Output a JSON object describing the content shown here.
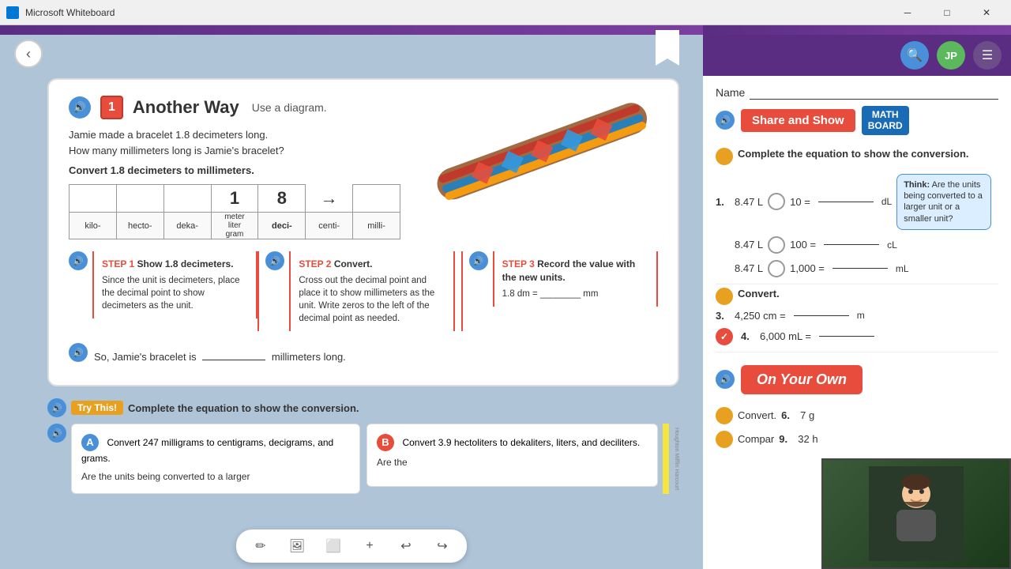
{
  "titleBar": {
    "title": "Microsoft Whiteboard",
    "minimizeLabel": "─",
    "maximizeLabel": "□",
    "closeLabel": "✕"
  },
  "leftPanel": {
    "anotherWay": {
      "badge": "1",
      "title": "Another Way",
      "subtitle": "Use a diagram.",
      "problemLine1": "Jamie made a bracelet 1.8 decimeters long.",
      "problemLine2": "How many millimeters long is Jamie's bracelet?",
      "convertText": "Convert 1.8 decimeters to millimeters.",
      "tableDigits": [
        "",
        "",
        "",
        "1",
        "8",
        "",
        ""
      ],
      "tableLabels": [
        "kilo-",
        "hecto-",
        "deka-",
        "meter\nliter\ngram",
        "deci-",
        "centi-",
        "milli-"
      ],
      "step1Title": "STEP 1",
      "step1Desc": "Show 1.8 decimeters.",
      "step1Body": "Since the unit is decimeters, place the decimal point to show decimeters as the unit.",
      "step2Title": "STEP 2",
      "step2Desc": "Convert.",
      "step2Body": "Cross out the decimal point and place it to show millimeters as the unit. Write zeros to the left of the decimal point as needed.",
      "step3Title": "STEP 3",
      "step3Desc": "Record the value with the new units.",
      "step3Eq": "1.8 dm = ________ mm",
      "soSentence": "So, Jamie's bracelet is ________ millimeters long."
    },
    "tryThis": {
      "badge": "Try This!",
      "instruction": "Complete the equation to show the conversion.",
      "problemA": {
        "label": "A",
        "question": "Convert 247 milligrams to centigrams, decigrams, and grams.",
        "subQuestion": "Are the units being converted to a larger"
      },
      "problemB": {
        "label": "B",
        "question": "Convert 3.9 hectoliters to dekaliters, liters, and deciliters.",
        "subQuestion": "Are the"
      }
    }
  },
  "toolbar": {
    "pencilLabel": "✏",
    "imageLabel": "🖼",
    "squareLabel": "⬜",
    "plusLabel": "+",
    "undoLabel": "↩",
    "redoLabel": "↪"
  },
  "rightPanel": {
    "header": {
      "searchIcon": "🔍",
      "userInitials": "JP",
      "menuIcon": "☰"
    },
    "nameLabel": "Name",
    "shareShow": {
      "label": "Share and Show",
      "mathBoardLine1": "MATH",
      "mathBoardLine2": "BOARD"
    },
    "completeText": "Complete the equation to show the conversion.",
    "problems": [
      {
        "num": "1.",
        "text": "8.47 L",
        "operator": "×",
        "operand": "10 =",
        "blank": "________",
        "unit": "dL"
      },
      {
        "num": "",
        "text": "8.47 L",
        "operator": "×",
        "operand": "100 =",
        "blank": "________",
        "unit": "cL"
      },
      {
        "num": "",
        "text": "8.47 L",
        "operator": "×",
        "operand": "1,000 =",
        "blank": "________",
        "unit": "mL"
      }
    ],
    "thinkText": "Think: Are the units being converted to a larger unit or a smaller unit?",
    "convertLabel": "Convert.",
    "convertProblems": [
      {
        "num": "3.",
        "text": "4,250 cm =",
        "blank": "________",
        "unit": "m"
      },
      {
        "num": "4.",
        "text": "6,000 mL ="
      }
    ],
    "onYourOwnLabel": "On Your Own",
    "convertProblems2": [
      {
        "num": "6.",
        "text": "7 g"
      }
    ],
    "compareLabel": "Compar",
    "compareProblems": [
      {
        "num": "9.",
        "text": "32 h"
      }
    ]
  }
}
